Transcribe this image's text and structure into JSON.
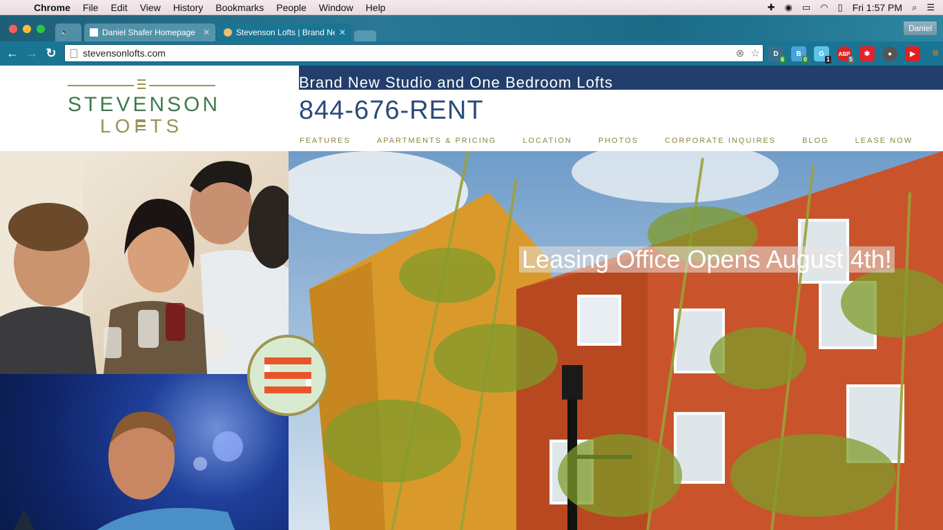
{
  "menubar": {
    "app": "Chrome",
    "items": [
      "File",
      "Edit",
      "View",
      "History",
      "Bookmarks",
      "People",
      "Window",
      "Help"
    ],
    "clock": "Fri 1:57 PM"
  },
  "tabs": [
    {
      "title": "",
      "icon": "speaker-icon"
    },
    {
      "title": "Daniel Shafer Homepage",
      "icon": "page-icon"
    },
    {
      "title": "Stevenson Lofts | Brand Ne",
      "icon": "stevenson-favicon"
    }
  ],
  "profile": {
    "name": "Daniel"
  },
  "omnibox": {
    "url": "stevensonlofts.com"
  },
  "extensions": [
    {
      "label": "D",
      "badge": "6",
      "color": "#3b6f8a",
      "badge_color": "#2d8a3e"
    },
    {
      "label": "B",
      "badge": "0",
      "color": "#4aa3d8",
      "badge_color": "#2d8a3e"
    },
    {
      "label": "G",
      "badge": "1",
      "color": "#5fc2e8",
      "badge_color": "#223"
    },
    {
      "label": "ABP",
      "badge": "5",
      "color": "#d62424",
      "badge_color": "#666"
    },
    {
      "label": "*",
      "badge": "",
      "color": "#e0242c",
      "badge_color": ""
    },
    {
      "label": "E",
      "badge": "",
      "color": "#555",
      "badge_color": ""
    },
    {
      "label": "▶",
      "badge": "",
      "color": "#e02020",
      "badge_color": ""
    },
    {
      "label": "≡",
      "badge": "",
      "color": "#e08a1f",
      "badge_color": ""
    }
  ],
  "site": {
    "logo_line1": "STEVENSON",
    "logo_line2": "LOFTS",
    "tagline": "Brand New Studio and One Bedroom Lofts",
    "phone": "844-676-RENT",
    "nav": [
      "FEATURES",
      "APARTMENTS & PRICING",
      "LOCATION",
      "PHOTOS",
      "CORPORATE INQUIRES",
      "BLOG",
      "LEASE NOW"
    ],
    "banner": "Leasing Office Opens August 4th!"
  },
  "colors": {
    "tagline_bg": "#223f6c",
    "phone": "#2c4a7a",
    "nav_text": "#8a8440",
    "logo_green": "#3f7a4e",
    "logo_gold": "#9a9150",
    "menu_bar_orange": "#e8552a"
  }
}
